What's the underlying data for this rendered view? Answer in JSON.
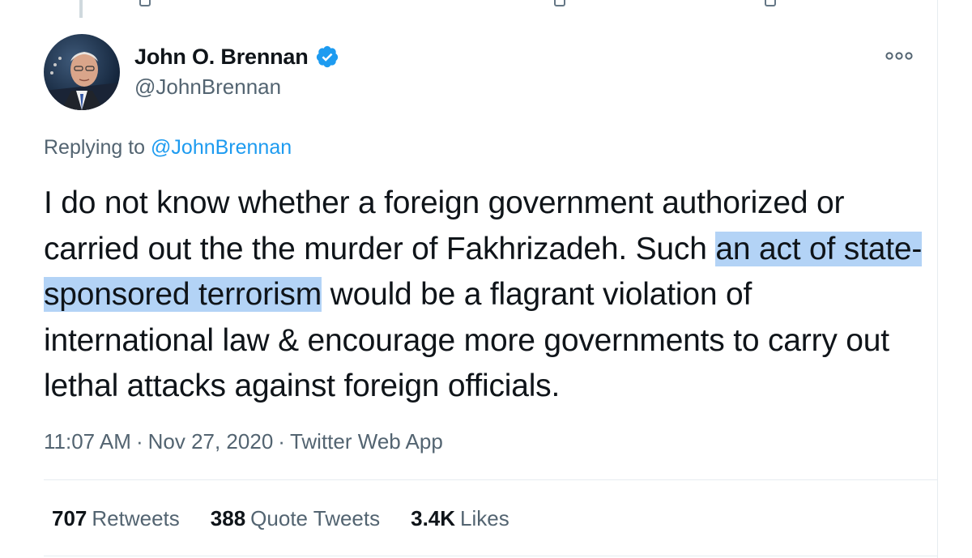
{
  "author": {
    "name": "John O. Brennan",
    "handle": "@JohnBrennan",
    "verified": true
  },
  "reply_context": {
    "prefix": "Replying to",
    "target": "@JohnBrennan"
  },
  "tweet": {
    "text_before": "I do not know whether a foreign government authorized or carried out the the murder of Fakhrizadeh. Such ",
    "text_highlighted": "an act of state-sponsored terrorism",
    "text_after": " would be a flagrant violation of international law & encourage more governments to carry out lethal attacks against foreign officials."
  },
  "meta": {
    "time": "11:07 AM",
    "separator": "·",
    "date": "Nov 27, 2020",
    "source": "Twitter Web App"
  },
  "stats": {
    "retweets_count": "707",
    "retweets_label": "Retweets",
    "quotes_count": "388",
    "quotes_label": "Quote Tweets",
    "likes_count": "3.4K",
    "likes_label": "Likes"
  },
  "colors": {
    "text": "#0f1419",
    "secondary": "#536471",
    "link": "#1d9bf0",
    "highlight": "#b3d3f6",
    "divider": "#e6ecf0"
  },
  "icons": {
    "verified": "verified-badge-icon",
    "more": "more-options-icon"
  }
}
